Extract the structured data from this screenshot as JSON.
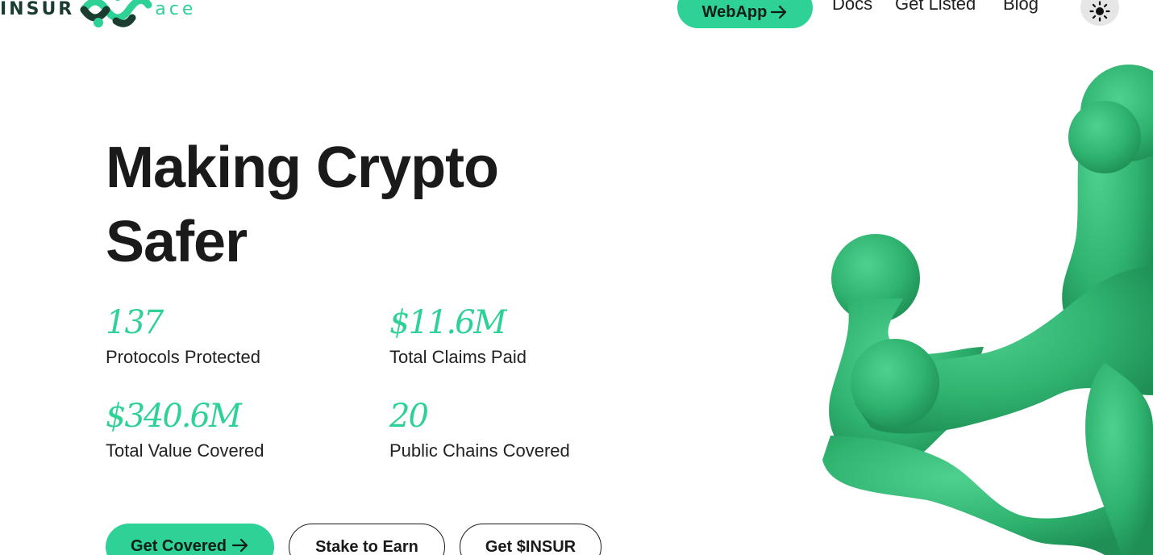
{
  "header": {
    "logo": {
      "left_text": "INSUR",
      "right_text": "ace"
    },
    "webapp_label": "WebApp",
    "nav": [
      {
        "label": "Docs"
      },
      {
        "label": "Get Listed"
      },
      {
        "label": "Blog"
      }
    ],
    "theme_icon": "sun-icon"
  },
  "hero": {
    "title_line1": "Making Crypto",
    "title_line2": "Safer",
    "stats": [
      {
        "value": "137",
        "label": "Protocols Protected"
      },
      {
        "value": "$11.6M",
        "label": "Total Claims Paid"
      },
      {
        "value": "$340.6M",
        "label": "Total Value Covered"
      },
      {
        "value": "20",
        "label": "Public Chains Covered"
      }
    ],
    "buttons": {
      "primary": "Get Covered",
      "stake": "Stake to Earn",
      "token": "Get $INSUR"
    }
  },
  "colors": {
    "accent": "#2ed196",
    "text": "#1a1a1a",
    "logo_dark": "#1b3d2f",
    "blob": "#2fb36f"
  },
  "icons": {
    "arrow": "arrow-right-icon",
    "illustration": "green-molecule-blob"
  }
}
